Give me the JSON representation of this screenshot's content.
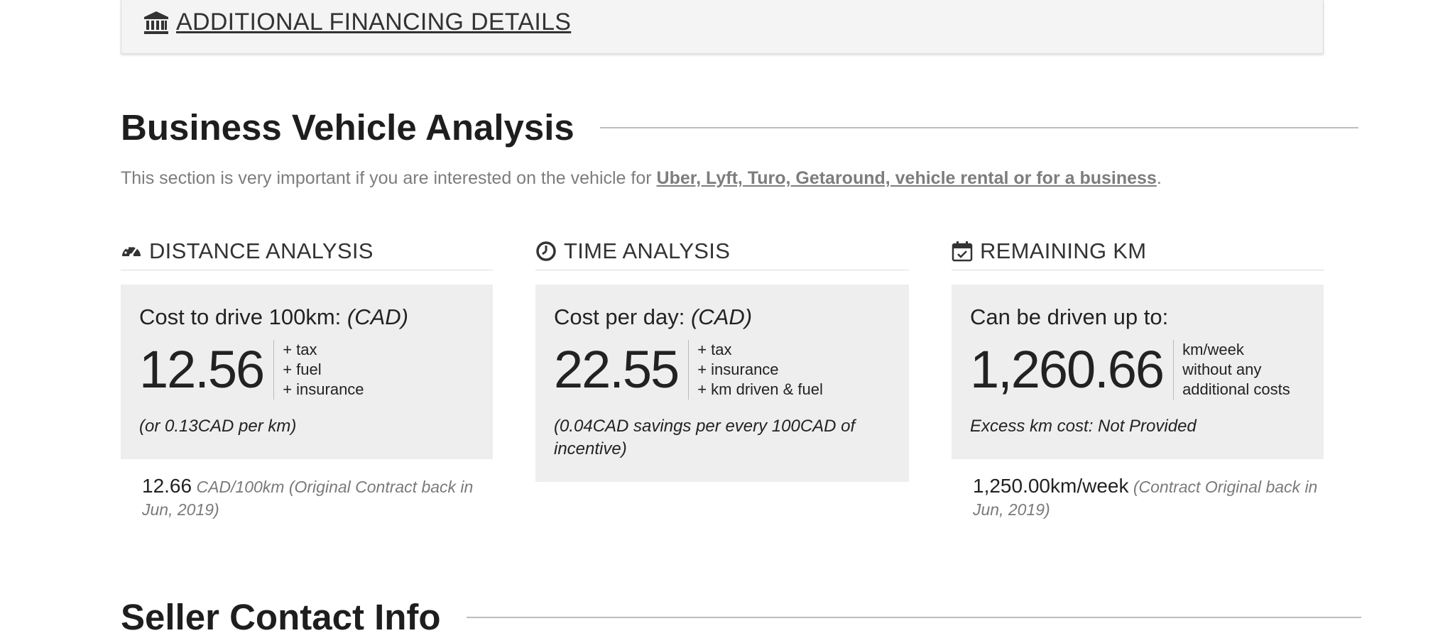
{
  "financing": {
    "label": "ADDITIONAL FINANCING DETAILS"
  },
  "analysis": {
    "title": "Business Vehicle Analysis",
    "intro_text": "This section is very important if you are interested on the vehicle for ",
    "intro_link": "Uber, Lyft, Turo, Getaround, vehicle rental or for a business",
    "intro_end": "."
  },
  "distance": {
    "heading": "DISTANCE ANALYSIS",
    "card_label": "Cost to drive 100km: ",
    "card_unit": "(CAD)",
    "value": "12.56",
    "extras": [
      "+ tax",
      "+ fuel",
      "+ insurance"
    ],
    "note": "(or 0.13CAD per km)",
    "below_value": "12.66",
    "below_text": "CAD/100km (Original Contract back in Jun, 2019)"
  },
  "time": {
    "heading": "TIME ANALYSIS",
    "card_label": "Cost per day: ",
    "card_unit": "(CAD)",
    "value": "22.55",
    "extras": [
      "+ tax",
      "+ insurance",
      "+ km driven & fuel"
    ],
    "note": "(0.04CAD savings per every 100CAD of incentive)"
  },
  "remaining": {
    "heading": "REMAINING KM",
    "card_label": "Can be driven up to:",
    "value": "1,260.66",
    "extras": [
      "km/week",
      "without any",
      "additional costs"
    ],
    "note": "Excess km cost: Not Provided",
    "below_value": "1,250.00km/week",
    "below_text": "(Contract Original back in Jun, 2019)"
  },
  "seller": {
    "title": "Seller Contact Info"
  }
}
